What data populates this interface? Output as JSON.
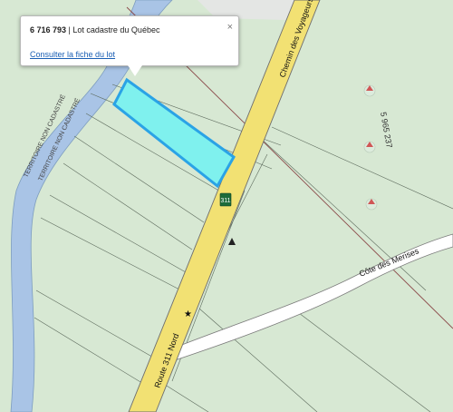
{
  "popup": {
    "lot_number": "6 716 793",
    "separator": " | ",
    "title": "Lot cadastre du Québec",
    "link_label": "Consulter la fiche du lot",
    "close_label": "×"
  },
  "map": {
    "territory_label_1": "TERRITOIRE NON CADASTRÉ",
    "territory_label_2": "TERRITOIRE NON CADASTRÉ",
    "lot_number_label": "5 965 237",
    "road_route_311": "Route 311 Nord",
    "road_chemin": "Chemin des Voyageurs",
    "road_cote": "Côte des Merises",
    "highway_shield": "311"
  },
  "colors": {
    "land": "#d7e8d3",
    "river": "#a9c4e6",
    "road": "#f2e173",
    "parcel_fill": "#7ff1ee",
    "parcel_stroke": "#2aa3e6",
    "link": "#1a5fb4"
  }
}
